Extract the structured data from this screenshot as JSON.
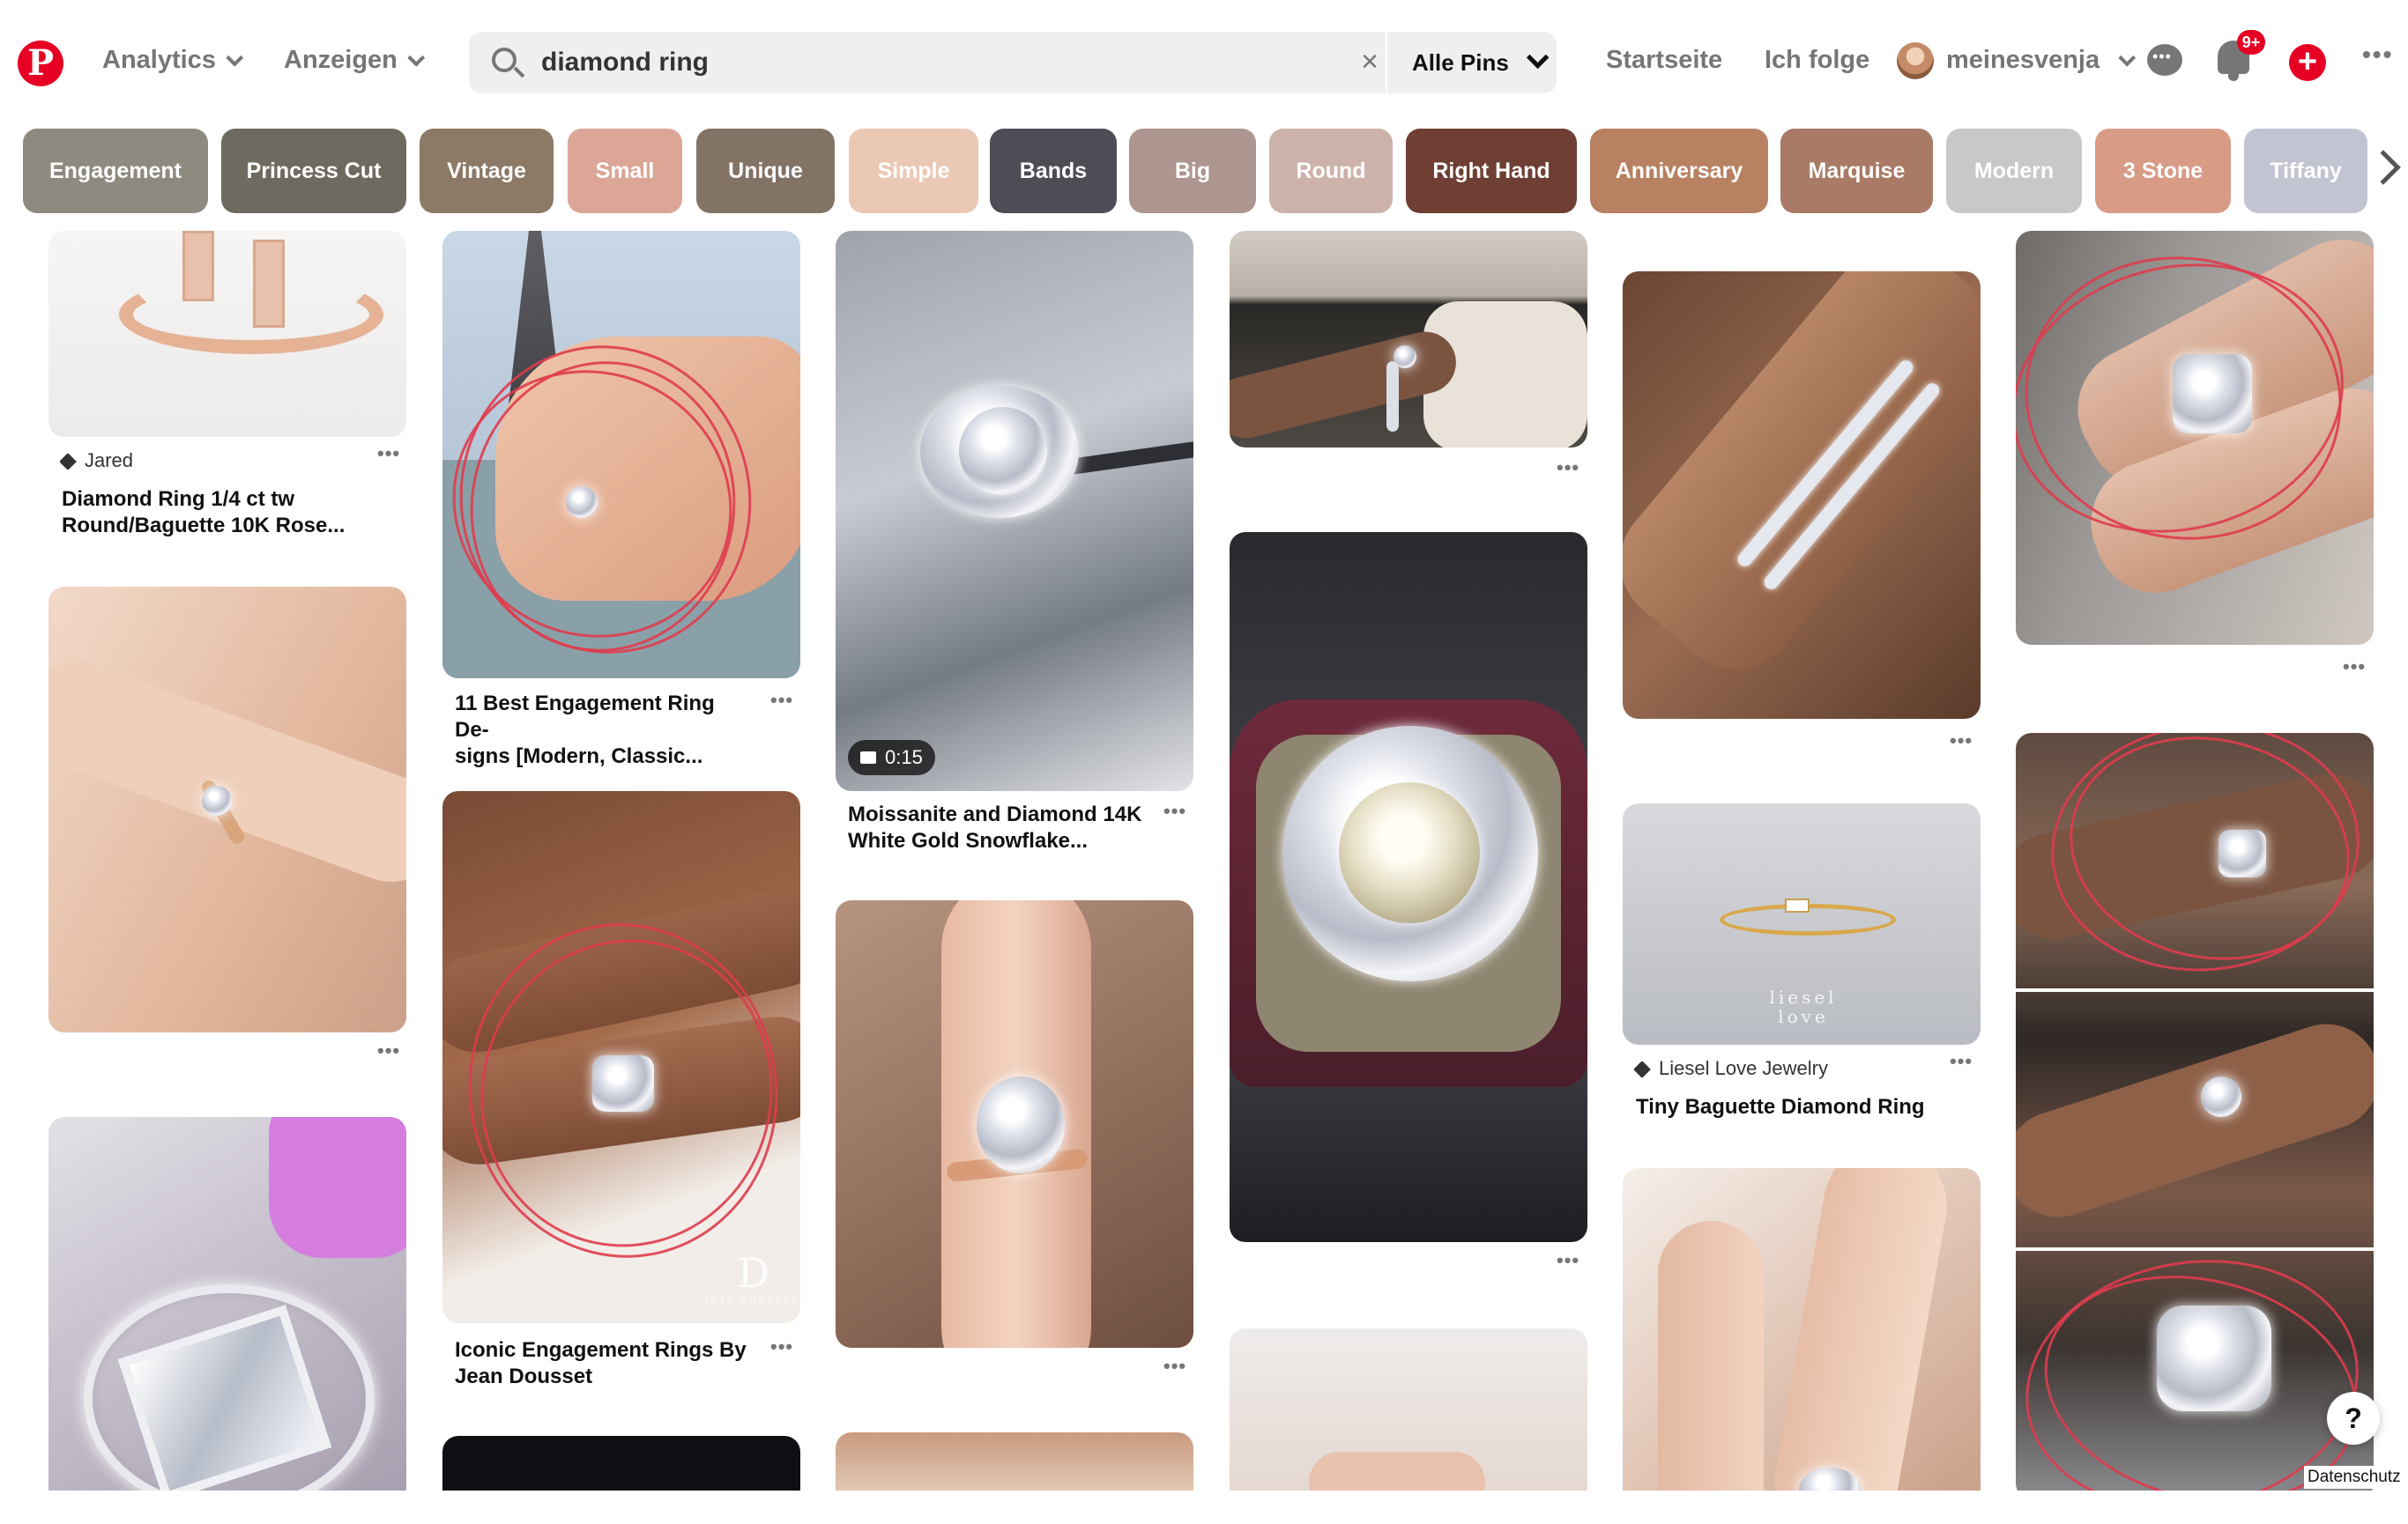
{
  "header": {
    "logo": "P",
    "nav_analytics": "Analytics",
    "nav_ads": "Anzeigen",
    "search": {
      "value": "diamond ring",
      "clear": "×",
      "filter": "Alle Pins"
    },
    "home": "Startseite",
    "following": "Ich folge",
    "username": "meinesvenja",
    "notifications_badge": "9+",
    "create": "+",
    "more": "•••"
  },
  "chips": [
    {
      "label": "Engagement",
      "color": "#8f8a80"
    },
    {
      "label": "Princess Cut",
      "color": "#6f6a60"
    },
    {
      "label": "Vintage",
      "color": "#8c7a66"
    },
    {
      "label": "Small",
      "color": "#dba696"
    },
    {
      "label": "Unique",
      "color": "#837365"
    },
    {
      "label": "Simple",
      "color": "#ebc8b4"
    },
    {
      "label": "Bands",
      "color": "#4c4d55"
    },
    {
      "label": "Big",
      "color": "#ad9690"
    },
    {
      "label": "Round",
      "color": "#ccb2aa"
    },
    {
      "label": "Right Hand",
      "color": "#6f3f33"
    },
    {
      "label": "Anniversary",
      "color": "#b88161"
    },
    {
      "label": "Marquise",
      "color": "#a97a66"
    },
    {
      "label": "Modern",
      "color": "#c8c8c8"
    },
    {
      "label": "3 Stone",
      "color": "#d89b86"
    },
    {
      "label": "Tiffany",
      "color": "#c3c4d2"
    }
  ],
  "pins": {
    "jared": {
      "source": "Jared",
      "title_line1": "Diamond Ring 1/4 ct tw",
      "title_line2": "Round/Baguette 10K Rose..."
    },
    "eiffel": {
      "title_line1": "11 Best Engagement Ring De-",
      "title_line2": "signs [Modern, Classic..."
    },
    "dousset": {
      "title_line1": "Iconic Engagement Rings By",
      "title_line2": "Jean Dousset",
      "watermark_letter": "D",
      "watermark_text": "JEAN DOUSSET"
    },
    "moissanite": {
      "video_duration": "0:15",
      "title_line1": "Moissanite and Diamond 14K",
      "title_line2": "White Gold Snowflake..."
    },
    "liesel": {
      "source": "Liesel Love Jewelry",
      "title": "Tiny Baguette Diamond Ring",
      "watermark_line1": "liesel",
      "watermark_line2": "love"
    },
    "more_label": "•••"
  },
  "help": "?",
  "privacy": "Datenschutz"
}
